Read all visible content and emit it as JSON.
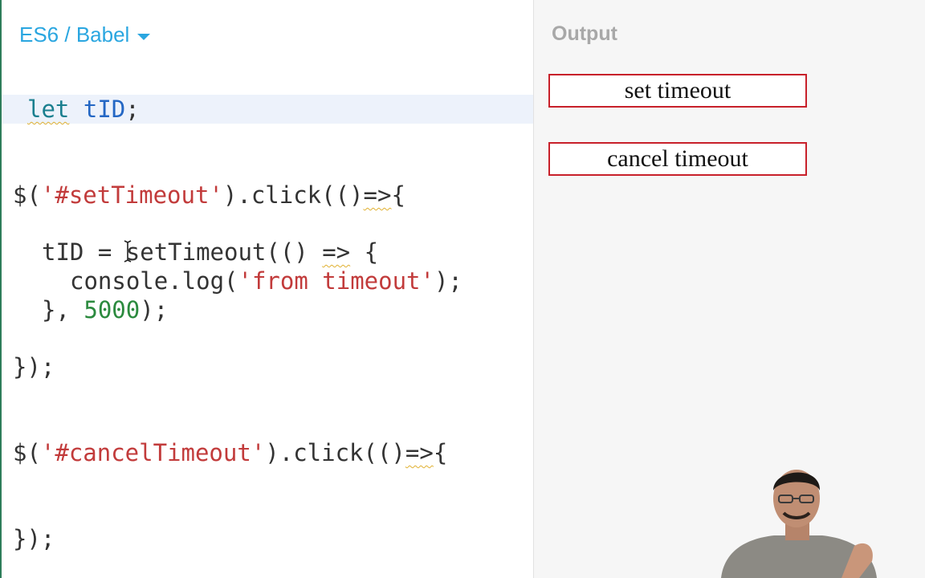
{
  "editor": {
    "language": "ES6 / Babel",
    "code": {
      "l1": {
        "kw": "let",
        "var": "tID",
        "rest": ";"
      },
      "l2": {
        "a": "$(",
        "str": "'#setTimeout'",
        "b": ").click(()",
        "arrow": "=>",
        "c": "{"
      },
      "l3": {
        "var": "tID",
        "a": " = ",
        "b": "setTimeout(() ",
        "arrow": "=>",
        "c": " {"
      },
      "l4": {
        "a": "console.log(",
        "str": "'from timeout'",
        "b": ");"
      },
      "l5": {
        "a": "}, ",
        "num": "5000",
        "b": ");"
      },
      "l6": "});",
      "l7": {
        "a": "$(",
        "str": "'#cancelTimeout'",
        "b": ").click(()",
        "arrow": "=>",
        "c": "{"
      },
      "l8": "});"
    }
  },
  "output": {
    "title": "Output",
    "buttons": {
      "set": "set timeout",
      "cancel": "cancel timeout"
    }
  },
  "icons": {
    "dropdown": "caret-down-icon",
    "cursor": "text-cursor-icon"
  },
  "colors": {
    "accent": "#2aa6e0",
    "button_border": "#c8202a",
    "keyword": "#1a7f8f",
    "variable": "#2467c4",
    "string": "#c23b3b",
    "number": "#2b8a3e"
  }
}
